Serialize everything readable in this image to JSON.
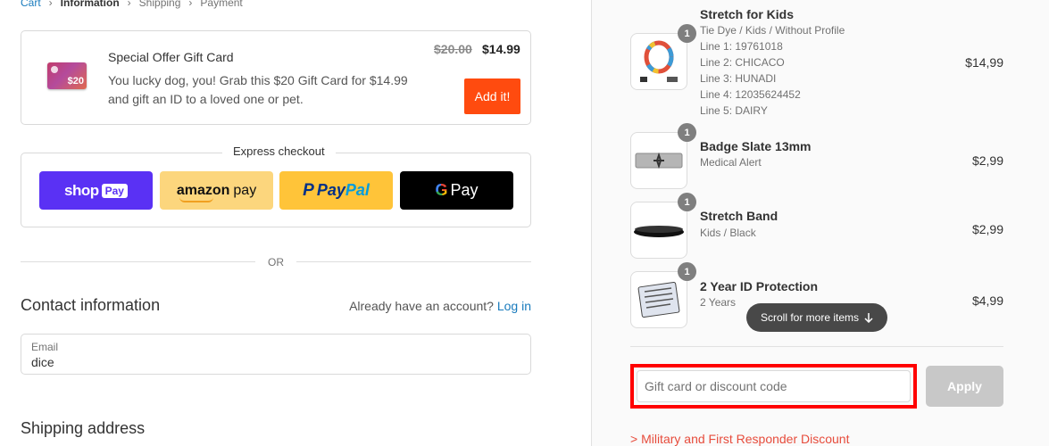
{
  "breadcrumb": {
    "items": [
      {
        "label": "Cart",
        "state": "link"
      },
      {
        "label": "Information",
        "state": "current"
      },
      {
        "label": "Shipping",
        "state": "inactive"
      },
      {
        "label": "Payment",
        "state": "inactive"
      }
    ],
    "separator": "›"
  },
  "offer": {
    "title": "Special Offer Gift Card",
    "description": "You lucky dog, you! Grab this $20 Gift Card for $14.99 and gift an ID to a loved one or pet.",
    "old_price": "$20.00",
    "new_price": "$14.99",
    "button_label": "Add it!",
    "image_amount": "$20"
  },
  "express": {
    "label": "Express checkout",
    "shop_text": "shop",
    "shop_pay": "Pay",
    "amazon_text": "amazon",
    "amazon_pay": "pay",
    "paypal_pay": "Pay",
    "paypal_pal": "Pal",
    "gpay_g": "G",
    "gpay_text": "Pay"
  },
  "divider_or": "OR",
  "contact": {
    "heading": "Contact information",
    "account_prompt": "Already have an account?",
    "login_label": "Log in",
    "email_label": "Email",
    "email_value": "dice"
  },
  "shipping": {
    "heading": "Shipping address"
  },
  "cart": {
    "items": [
      {
        "qty": "1",
        "name": "Stretch for Kids",
        "meta": [
          "Tie Dye / Kids / Without Profile",
          "Line 1: 19761018",
          "Line 2: CHICACO",
          "Line 3: HUNADI",
          "Line 4: 12035624452",
          "Line 5: DAIRY"
        ],
        "price": "$14,99"
      },
      {
        "qty": "1",
        "name": "Badge Slate 13mm",
        "meta": [
          "Medical Alert"
        ],
        "price": "$2,99"
      },
      {
        "qty": "1",
        "name": "Stretch Band",
        "meta": [
          "Kids / Black"
        ],
        "price": "$2,99"
      },
      {
        "qty": "1",
        "name": "2 Year ID Protection",
        "meta": [
          "2 Years"
        ],
        "price": "$4,99"
      }
    ],
    "scroll_hint": "Scroll for more items",
    "discount_placeholder": "Gift card or discount code",
    "apply_label": "Apply",
    "military_link": "> Military and First Responder Discount"
  },
  "colors": {
    "accent_link": "#197bbd",
    "offer_button": "#ff4b0f",
    "shop_pay": "#5a31f4",
    "amazon_pay": "#fcd67d",
    "paypal": "#ffc439",
    "highlight_box": "#ff0000",
    "military_link": "#e74c3c"
  }
}
